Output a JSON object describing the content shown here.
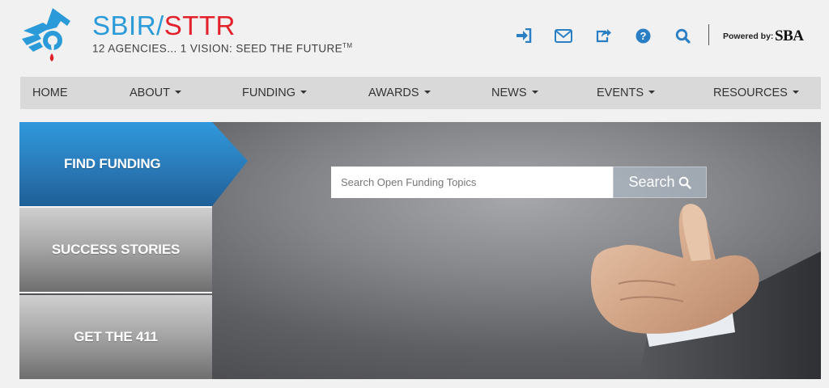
{
  "brand": {
    "name_part1": "SBIR",
    "separator": "/",
    "name_part2": "STTR",
    "tagline": "12 AGENCIES... 1 VISION: SEED THE FUTURE",
    "trademark": "TM",
    "colors": {
      "blue": "#2a9bd8",
      "red": "#e2212b"
    }
  },
  "toolbar": {
    "icons": [
      "sign-in-icon",
      "mail-icon",
      "share-icon",
      "help-icon",
      "search-icon"
    ],
    "powered_by": "Powered by:",
    "partner": "SBA"
  },
  "nav": {
    "items": [
      {
        "label": "HOME",
        "dropdown": false
      },
      {
        "label": "ABOUT",
        "dropdown": true
      },
      {
        "label": "FUNDING",
        "dropdown": true
      },
      {
        "label": "AWARDS",
        "dropdown": true
      },
      {
        "label": "NEWS",
        "dropdown": true
      },
      {
        "label": "EVENTS",
        "dropdown": true
      },
      {
        "label": "RESOURCES",
        "dropdown": true
      }
    ]
  },
  "hero": {
    "tabs": [
      {
        "label": "FIND FUNDING",
        "active": true
      },
      {
        "label": "SUCCESS STORIES",
        "active": false
      },
      {
        "label": "GET THE 411",
        "active": false
      }
    ],
    "search": {
      "placeholder": "Search Open Funding Topics",
      "value": "",
      "button_label": "Search"
    }
  }
}
